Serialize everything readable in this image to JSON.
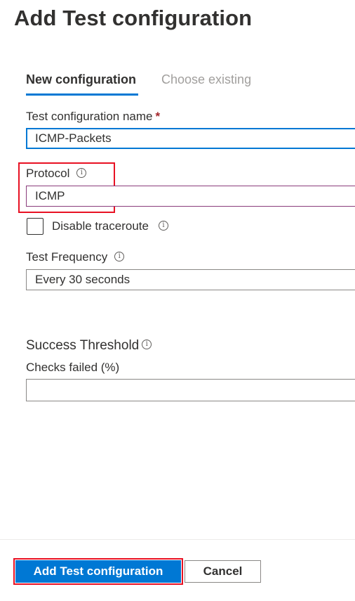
{
  "page": {
    "title": "Add Test configuration"
  },
  "tabs": [
    {
      "label": "New configuration",
      "active": true
    },
    {
      "label": "Choose existing",
      "active": false
    }
  ],
  "form": {
    "name": {
      "label": "Test configuration name",
      "required_marker": "*",
      "value": "ICMP-Packets"
    },
    "protocol": {
      "label": "Protocol",
      "value": "ICMP",
      "info_icon": "info-icon"
    },
    "disable_traceroute": {
      "label": "Disable traceroute",
      "checked": false,
      "info_icon": "info-icon"
    },
    "frequency": {
      "label": "Test Frequency",
      "value": "Every 30 seconds",
      "info_icon": "info-icon"
    },
    "success_threshold": {
      "heading": "Success Threshold",
      "info_icon": "info-icon",
      "checks_failed_label": "Checks failed (%)",
      "checks_failed_value": ""
    }
  },
  "footer": {
    "add_label": "Add Test configuration",
    "cancel_label": "Cancel"
  },
  "colors": {
    "accent": "#0078d4",
    "highlight": "#e81123",
    "required": "#a4262c",
    "protocol_border": "#8a3c7b"
  }
}
